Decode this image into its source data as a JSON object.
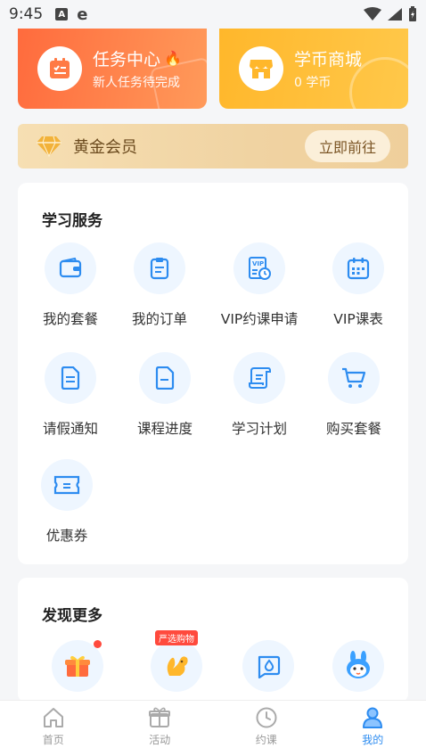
{
  "status_bar": {
    "time": "9:45",
    "a_icon": "A",
    "e_icon": "e"
  },
  "top_cards": {
    "task": {
      "title": "任务中心",
      "subtitle": "新人任务待完成"
    },
    "mall": {
      "title": "学币商城",
      "subtitle": "0 学币"
    }
  },
  "vip": {
    "label": "黄金会员",
    "button": "立即前往"
  },
  "services": {
    "title": "学习服务",
    "items": [
      {
        "label": "我的套餐",
        "icon": "wallet-icon"
      },
      {
        "label": "我的订单",
        "icon": "clipboard-icon"
      },
      {
        "label": "VIP约课申请",
        "icon": "vip-schedule-icon"
      },
      {
        "label": "VIP课表",
        "icon": "calendar-icon"
      },
      {
        "label": "请假通知",
        "icon": "document-icon"
      },
      {
        "label": "课程进度",
        "icon": "progress-doc-icon"
      },
      {
        "label": "学习计划",
        "icon": "scroll-icon"
      },
      {
        "label": "购买套餐",
        "icon": "cart-icon"
      },
      {
        "label": "优惠券",
        "icon": "coupon-icon"
      }
    ]
  },
  "discover": {
    "title": "发现更多",
    "items": [
      {
        "icon": "gift-icon",
        "badge": ""
      },
      {
        "icon": "squirrel-icon",
        "badge": "严选购物"
      },
      {
        "icon": "chat-drop-icon",
        "badge": ""
      },
      {
        "icon": "rabbit-mascot-icon",
        "badge": ""
      }
    ]
  },
  "bottom_nav": {
    "items": [
      {
        "label": "首页"
      },
      {
        "label": "活动"
      },
      {
        "label": "约课"
      },
      {
        "label": "我的"
      }
    ]
  },
  "colors": {
    "accent": "#2d8cf0",
    "task_card": "#ff7a45",
    "mall_card": "#ffbb33",
    "vip_text": "#6b4a1e"
  }
}
